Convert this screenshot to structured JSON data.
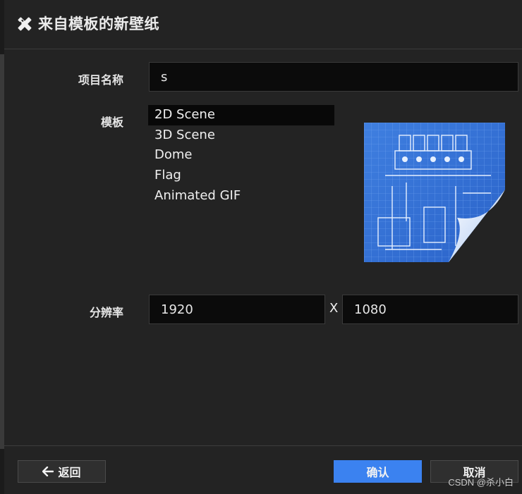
{
  "dialog": {
    "title": "来自模板的新壁纸",
    "title_icon": "pencil-ruler-icon"
  },
  "form": {
    "project_name_label": "项目名称",
    "project_name_value": "s",
    "template_label": "模板",
    "templates": [
      {
        "label": "2D Scene",
        "selected": true
      },
      {
        "label": "3D Scene",
        "selected": false
      },
      {
        "label": "Dome",
        "selected": false
      },
      {
        "label": "Flag",
        "selected": false
      },
      {
        "label": "Animated GIF",
        "selected": false
      }
    ],
    "preview_image": "blueprint-icon",
    "resolution_label": "分辨率",
    "resolution_width": "1920",
    "resolution_separator": "X",
    "resolution_height": "1080"
  },
  "footer": {
    "back_label": "返回",
    "back_icon": "arrow-left-icon",
    "confirm_label": "确认",
    "cancel_label": "取消"
  },
  "watermark": "CSDN @杀小白",
  "colors": {
    "accent": "#3b82f0",
    "background": "#232323",
    "input_background": "#0b0b0b"
  }
}
